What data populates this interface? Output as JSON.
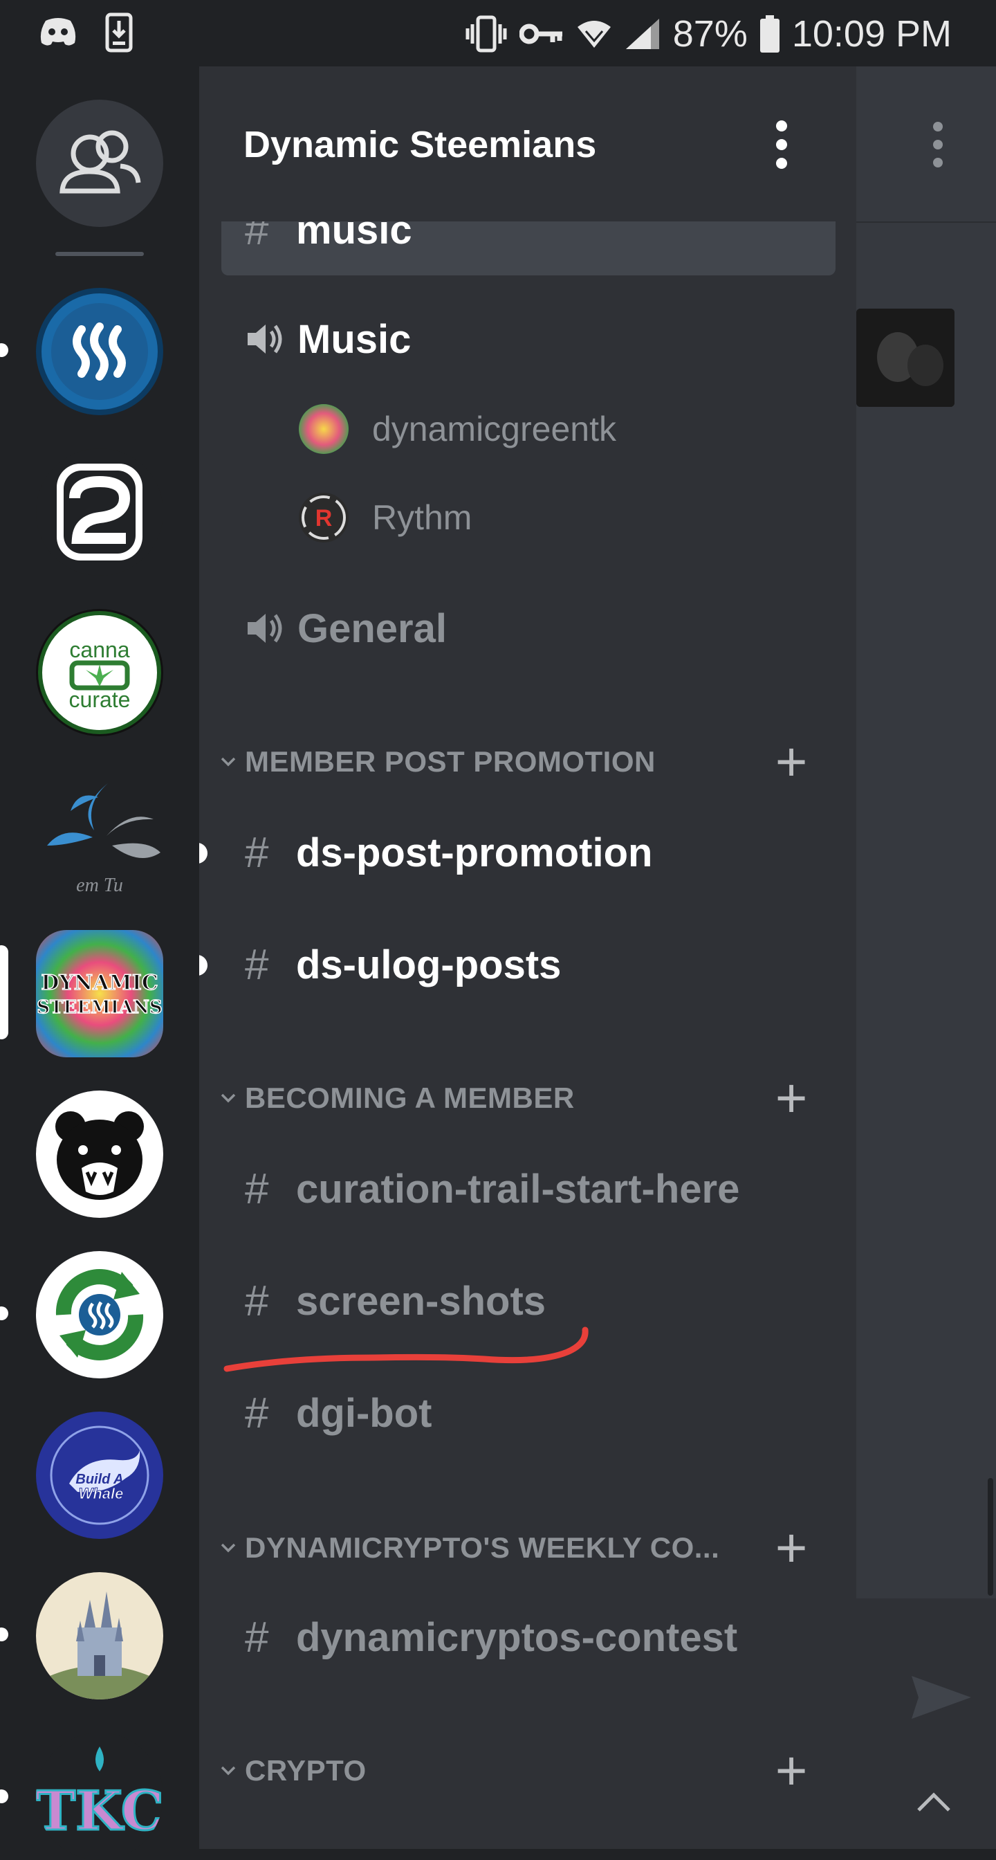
{
  "status_bar": {
    "left_icons": [
      "discord-icon",
      "download-icon"
    ],
    "right_icons": [
      "vibrate-icon",
      "vpn-key-icon",
      "wifi-icon",
      "signal-icon",
      "battery-icon"
    ],
    "battery": "87%",
    "time": "10:09 PM"
  },
  "guild_rail": {
    "items": [
      {
        "name": "home-friends",
        "icon": "friends-icon"
      },
      {
        "name": "steem-guild",
        "icon": "steem-icon"
      },
      {
        "name": "2-guild",
        "icon": "number-2-icon"
      },
      {
        "name": "canna-curate-guild",
        "text_top": "canna",
        "text_bottom": "curate"
      },
      {
        "name": "steem-tube-guild",
        "text": "em Tu"
      },
      {
        "name": "dynamic-steemians-guild",
        "text_top": "DYNAMIC",
        "text_bottom": "STEEMIANS"
      },
      {
        "name": "bear-guild",
        "icon": "bear-icon"
      },
      {
        "name": "steem-recycle-guild",
        "icon": "recycle-icon"
      },
      {
        "name": "build-a-whale-guild",
        "text_top": "Build A",
        "text_bottom": "Whale"
      },
      {
        "name": "castle-guild",
        "icon": "castle-icon"
      },
      {
        "name": "tkc-guild",
        "text": "TKC"
      }
    ]
  },
  "drawer": {
    "server_name": "Dynamic Steemians",
    "selected_channel": "music",
    "voice_channels": [
      {
        "name": "Music",
        "users": [
          "dynamicgreentk",
          "Rythm"
        ]
      },
      {
        "name": "General",
        "users": []
      }
    ],
    "categories": [
      {
        "name": "MEMBER POST PROMOTION",
        "channels": [
          "ds-post-promotion",
          "ds-ulog-posts"
        ]
      },
      {
        "name": "BECOMING A MEMBER",
        "channels": [
          "curation-trail-start-here",
          "screen-shots",
          "dgi-bot"
        ]
      },
      {
        "name": "DYNAMICRYPTO'S WEEKLY CO...",
        "channels": [
          "dynamicryptos-contest"
        ]
      },
      {
        "name": "CRYPTO",
        "channels": []
      }
    ],
    "hash": "#",
    "plus": "+"
  },
  "colors": {
    "rail_bg": "#202225",
    "drawer_bg": "#2f3136",
    "chat_bg": "#36393f",
    "annotation_red": "#e8403a"
  }
}
